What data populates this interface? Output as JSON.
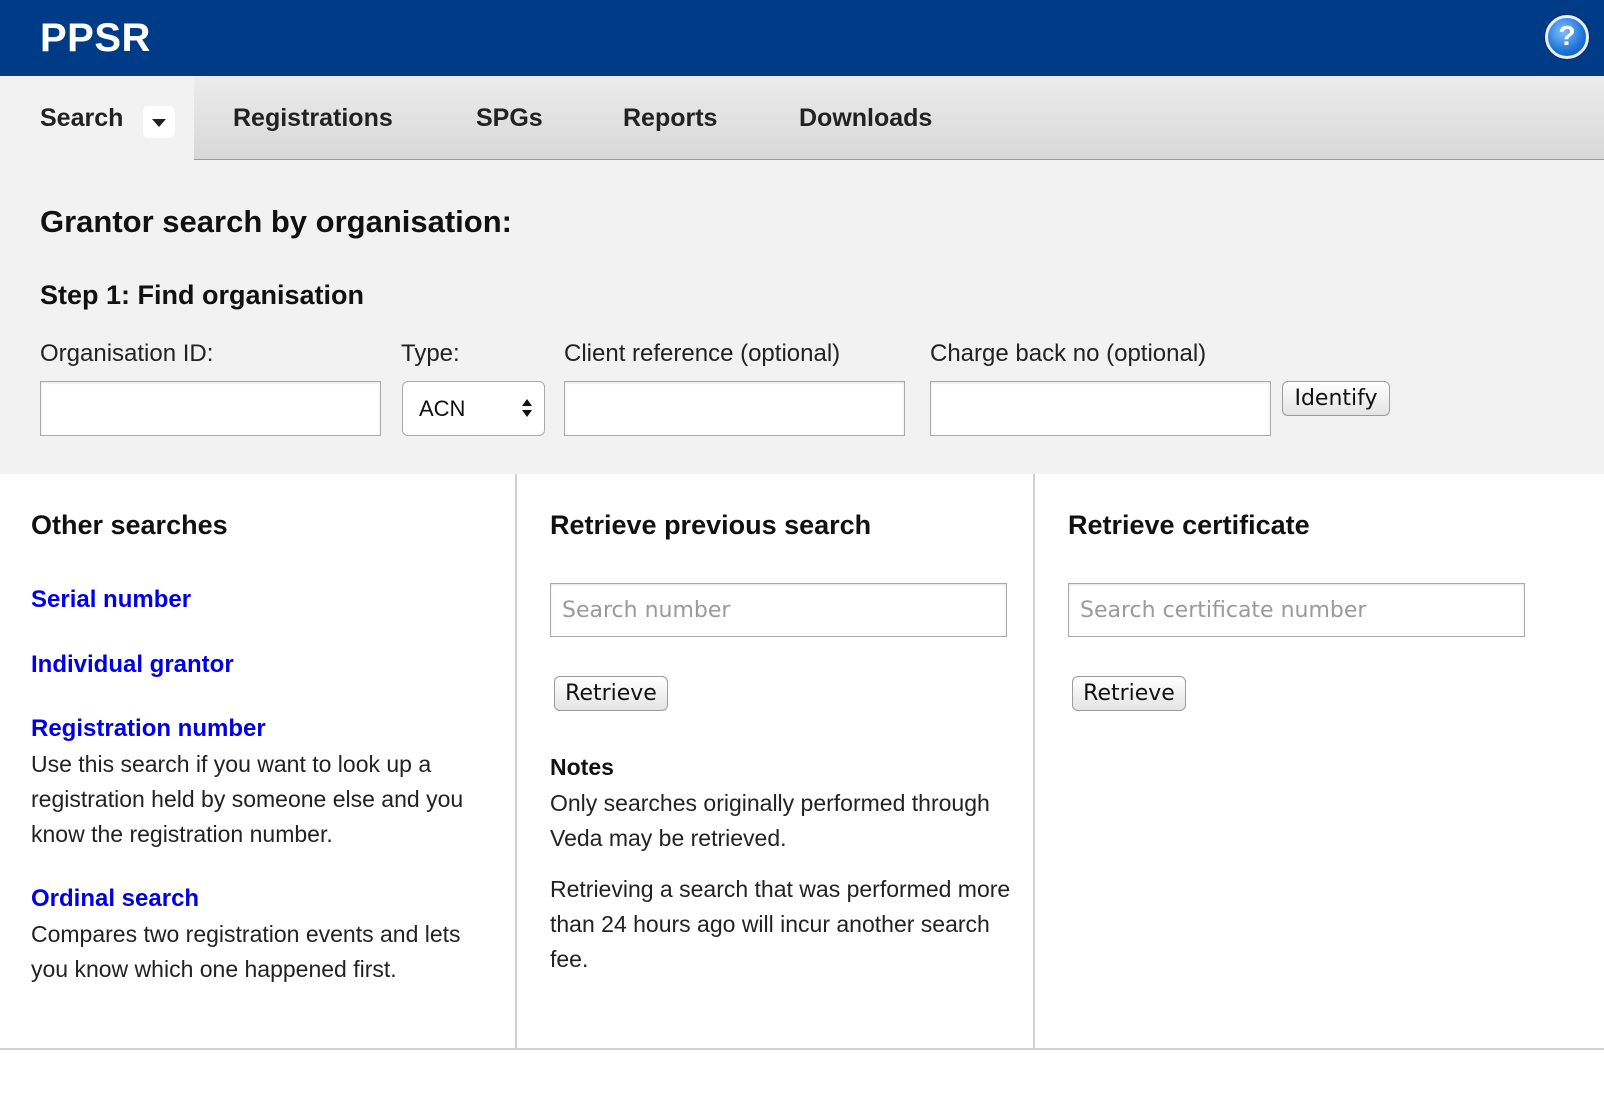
{
  "header": {
    "brand": "PPSR",
    "help_glyph": "?",
    "help_icon": "help-circle-icon",
    "colors": {
      "header_bg": "#003b87",
      "link": "#0000e6",
      "panel_bg": "#f2f2f2"
    }
  },
  "nav": {
    "items": [
      {
        "label": "Search"
      },
      {
        "label": "Registrations"
      },
      {
        "label": "SPGs"
      },
      {
        "label": "Reports"
      },
      {
        "label": "Downloads"
      }
    ],
    "active": "Search",
    "dropdown_icon": "chevron-down-icon"
  },
  "grantor": {
    "title": "Grantor search by organisation:",
    "step_title": "Step 1: Find organisation",
    "org_id_label": "Organisation ID:",
    "org_id_value": "",
    "type_label": "Type:",
    "type_value": "ACN",
    "client_ref_label": "Client reference (optional)",
    "client_ref_value": "",
    "charge_back_label": "Charge back no (optional)",
    "charge_back_value": "",
    "identify_label": "Identify"
  },
  "other_searches": {
    "title": "Other searches",
    "items": [
      {
        "label": "Serial number",
        "desc": ""
      },
      {
        "label": "Individual grantor",
        "desc": ""
      },
      {
        "label": "Registration number",
        "desc": "Use this search if you want to look up a registration held by someone else and you know the registration number."
      },
      {
        "label": "Ordinal search",
        "desc": "Compares two registration events and lets you know which one happened first."
      }
    ]
  },
  "retrieve_previous": {
    "title": "Retrieve previous search",
    "placeholder": "Search number",
    "button": "Retrieve",
    "notes_title": "Notes",
    "notes": [
      "Only searches originally performed through Veda may be retrieved.",
      "Retrieving a search that was performed more than 24 hours ago will incur another search fee."
    ]
  },
  "retrieve_certificate": {
    "title": "Retrieve certificate",
    "placeholder": "Search certificate number",
    "button": "Retrieve"
  }
}
